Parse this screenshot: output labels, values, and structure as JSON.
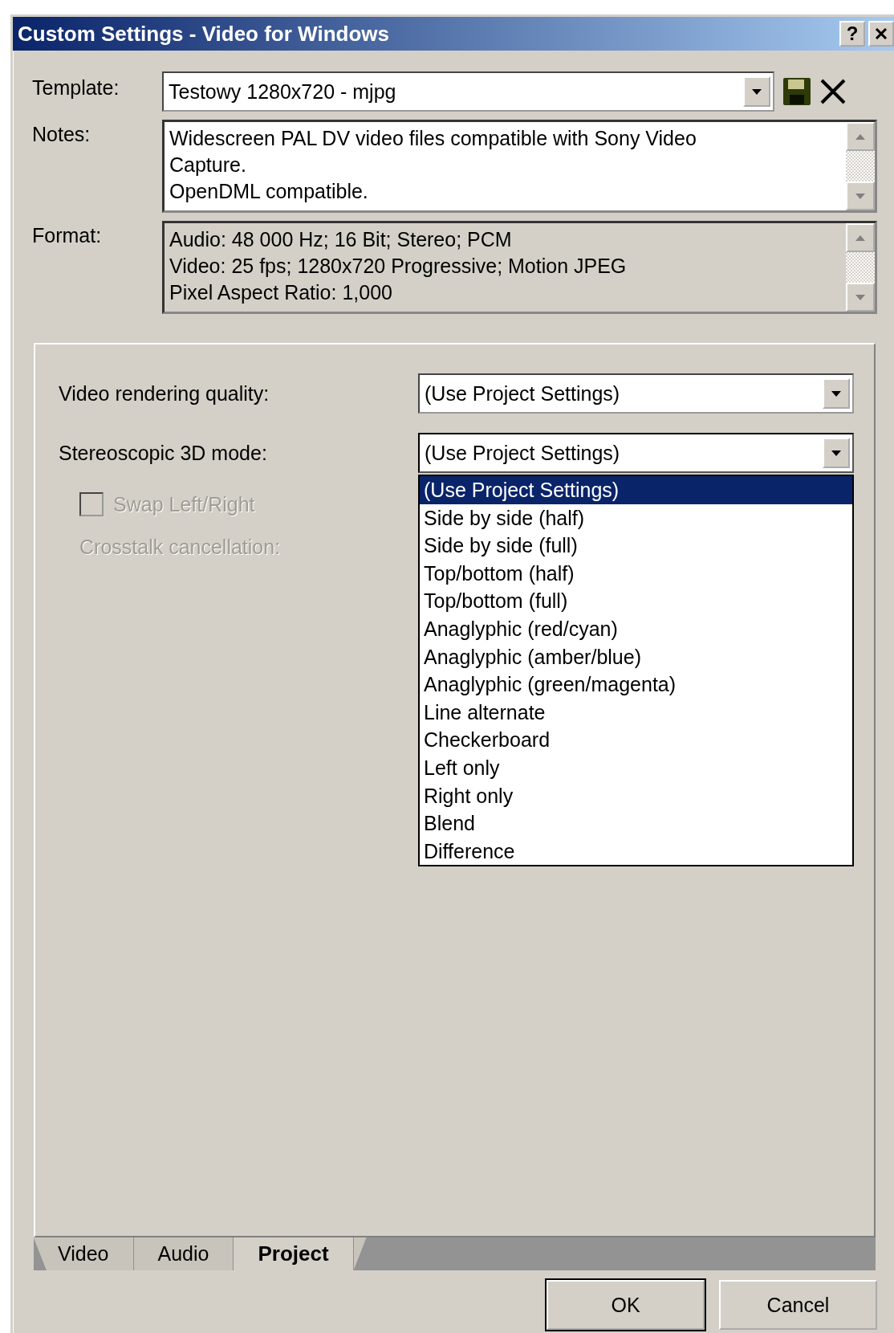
{
  "window": {
    "title": "Custom Settings - Video for Windows",
    "buttons": [
      {
        "kind": "help",
        "label": "?"
      },
      {
        "kind": "close"
      }
    ]
  },
  "template": {
    "label": "Template:",
    "value": "Testowy 1280x720 - mjpg",
    "actions": [
      {
        "kind": "save"
      },
      {
        "kind": "delete"
      }
    ]
  },
  "notes": {
    "label": "Notes:",
    "read_only": false,
    "lines": [
      "Widescreen PAL DV video files compatible with Sony Video",
      "Capture.",
      "OpenDML compatible."
    ]
  },
  "format": {
    "label": "Format:",
    "read_only": true,
    "lines": [
      "Audio: 48 000 Hz; 16 Bit; Stereo; PCM",
      "Video: 25 fps; 1280x720 Progressive; Motion JPEG",
      "Pixel Aspect Ratio: 1,000"
    ]
  },
  "settings": [
    {
      "kind": "combo",
      "label": "Video rendering quality:",
      "value": "(Use Project Settings)",
      "expanded": false
    },
    {
      "kind": "combo",
      "label": "Stereoscopic 3D mode:",
      "value": "(Use Project Settings)",
      "expanded": true,
      "options": [
        {
          "label": "(Use Project Settings)",
          "selected": true
        },
        {
          "label": "Side by side (half)",
          "selected": false
        },
        {
          "label": "Side by side (full)",
          "selected": false
        },
        {
          "label": "Top/bottom (half)",
          "selected": false
        },
        {
          "label": "Top/bottom (full)",
          "selected": false
        },
        {
          "label": "Anaglyphic (red/cyan)",
          "selected": false
        },
        {
          "label": "Anaglyphic (amber/blue)",
          "selected": false
        },
        {
          "label": "Anaglyphic (green/magenta)",
          "selected": false
        },
        {
          "label": "Line alternate",
          "selected": false
        },
        {
          "label": "Checkerboard",
          "selected": false
        },
        {
          "label": "Left only",
          "selected": false
        },
        {
          "label": "Right only",
          "selected": false
        },
        {
          "label": "Blend",
          "selected": false
        },
        {
          "label": "Difference",
          "selected": false
        }
      ]
    },
    {
      "kind": "checkbox",
      "label": "Swap Left/Right",
      "checked": false,
      "disabled": true
    },
    {
      "kind": "label",
      "label": "Crosstalk cancellation:",
      "disabled": true
    }
  ],
  "tabs": [
    {
      "label": "Video",
      "selected": false
    },
    {
      "label": "Audio",
      "selected": false
    },
    {
      "label": "Project",
      "selected": true
    }
  ],
  "buttons": [
    {
      "label": "OK",
      "default": true
    },
    {
      "label": "Cancel",
      "default": false
    }
  ]
}
